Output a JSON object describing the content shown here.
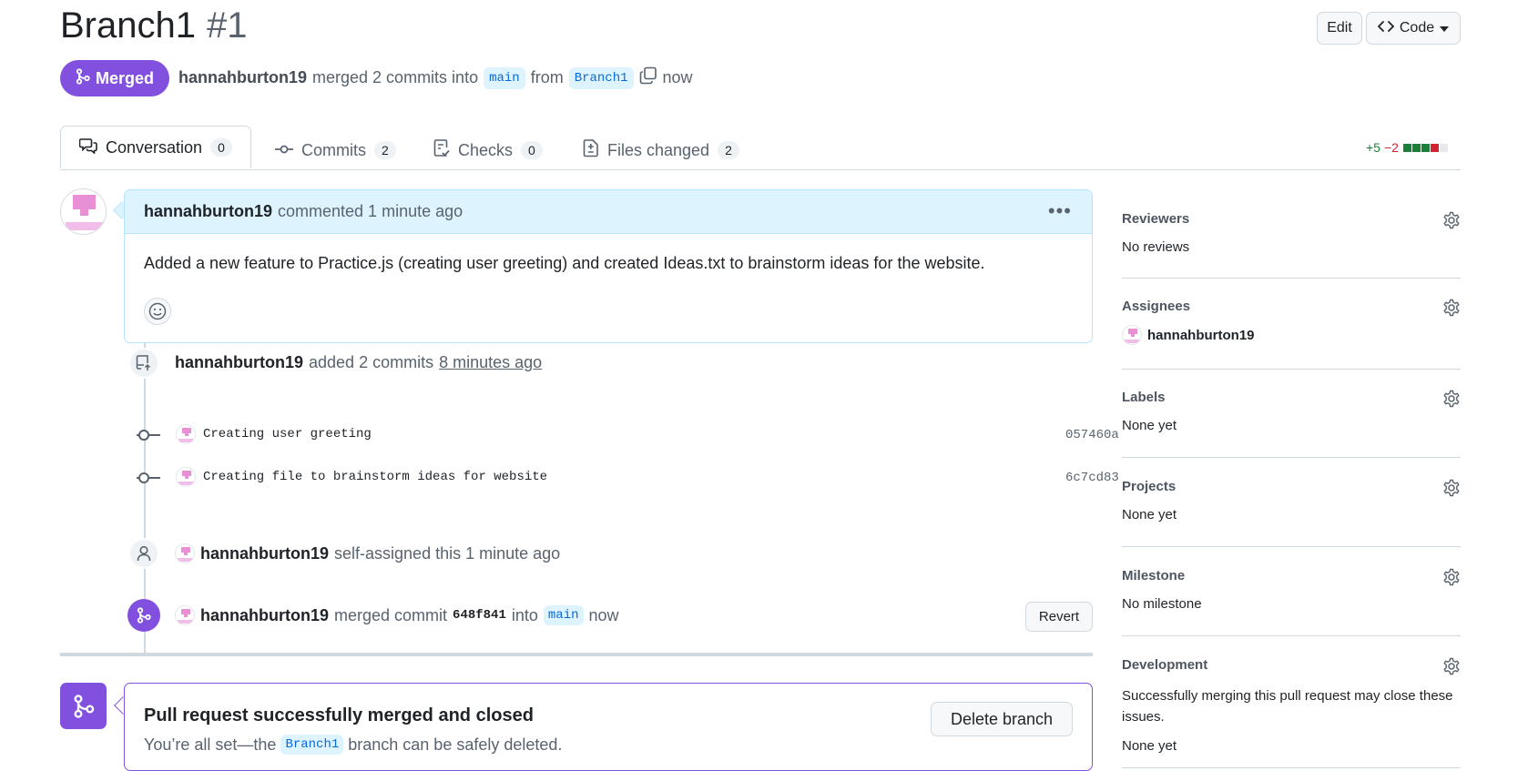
{
  "header": {
    "title": "Branch1",
    "number": "#1",
    "edit_label": "Edit",
    "code_label": "Code"
  },
  "status": {
    "badge": "Merged",
    "author": "hannahburton19",
    "action": "merged 2 commits into",
    "base_branch": "main",
    "from_word": "from",
    "head_branch": "Branch1",
    "time": "now"
  },
  "tabs": [
    {
      "label": "Conversation",
      "count": "0",
      "icon": "comment-discussion-icon"
    },
    {
      "label": "Commits",
      "count": "2",
      "icon": "git-commit-icon"
    },
    {
      "label": "Checks",
      "count": "0",
      "icon": "checklist-icon"
    },
    {
      "label": "Files changed",
      "count": "2",
      "icon": "file-diff-icon"
    }
  ],
  "diffstat": {
    "additions": "+5",
    "deletions": "−2"
  },
  "comment": {
    "author": "hannahburton19",
    "action": "commented 1 minute ago",
    "body": "Added a new feature to Practice.js (creating user greeting) and created Ideas.txt to brainstorm ideas for the website."
  },
  "timeline": {
    "commits_event": {
      "author": "hannahburton19",
      "action": "added 2 commits",
      "time": "8 minutes ago"
    },
    "commits": [
      {
        "message": "Creating user greeting",
        "sha": "057460a"
      },
      {
        "message": "Creating file to brainstorm ideas for website",
        "sha": "6c7cd83"
      }
    ],
    "assign_event": {
      "author": "hannahburton19",
      "action": "self-assigned this 1 minute ago"
    },
    "merge_event": {
      "author": "hannahburton19",
      "action": "merged commit",
      "sha": "648f841",
      "into": "into",
      "branch": "main",
      "time": "now",
      "revert_label": "Revert"
    }
  },
  "merge_box": {
    "title": "Pull request successfully merged and closed",
    "sub_prefix": "You’re all set—the",
    "branch": "Branch1",
    "sub_suffix": "branch can be safely deleted.",
    "delete_label": "Delete branch"
  },
  "sidebar": {
    "reviewers": {
      "title": "Reviewers",
      "value": "No reviews"
    },
    "assignees": {
      "title": "Assignees",
      "value": "hannahburton19"
    },
    "labels": {
      "title": "Labels",
      "value": "None yet"
    },
    "projects": {
      "title": "Projects",
      "value": "None yet"
    },
    "milestone": {
      "title": "Milestone",
      "value": "No milestone"
    },
    "development": {
      "title": "Development",
      "description": "Successfully merging this pull request may close these issues.",
      "value": "None yet"
    }
  },
  "colors": {
    "merged_purple": "#8250df",
    "link_blue": "#0969da",
    "added_green": "#1a7f37",
    "deleted_red": "#d1242f"
  }
}
